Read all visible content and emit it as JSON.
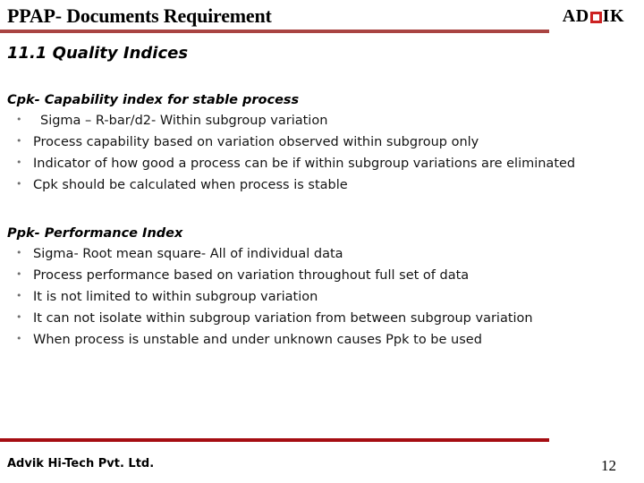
{
  "header": {
    "title": "PPAP- Documents Requirement",
    "logo": {
      "text_before": "AD",
      "text_after": "IK",
      "mark_name": "square-mark",
      "mark_color": "#cc2222"
    },
    "rule_color": "#a94442"
  },
  "section": {
    "heading": "11.1 Quality Indices"
  },
  "blocks": [
    {
      "title": "Cpk- Capability index for stable process",
      "bullets": [
        "Sigma – R-bar/d2- Within subgroup variation",
        "Process capability based on variation observed within subgroup only",
        "Indicator of how good a process can be if within subgroup variations are eliminated",
        "Cpk should be calculated when process is stable"
      ]
    },
    {
      "title": "Ppk- Performance Index",
      "bullets": [
        "Sigma- Root mean square- All of individual data",
        "Process performance based on variation throughout full set of data",
        "It is not limited to within subgroup variation",
        "It can not isolate within subgroup variation from between subgroup variation",
        "When process is unstable and under unknown causes Ppk to be used"
      ]
    }
  ],
  "footer": {
    "company": "Advik Hi-Tech Pvt. Ltd.",
    "page_number": "12",
    "rule_color": "#a50d12"
  }
}
